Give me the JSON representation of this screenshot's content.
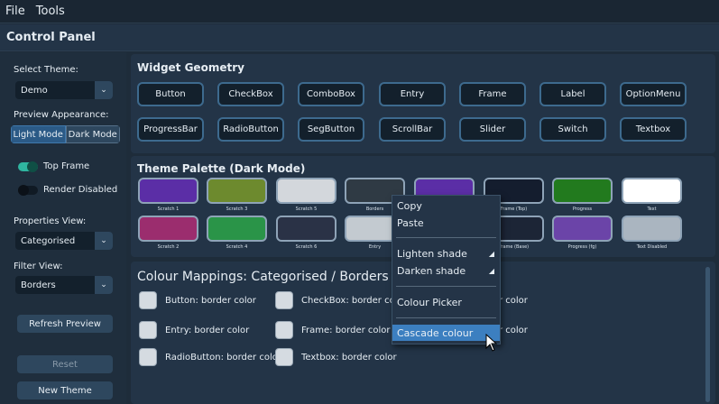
{
  "menu": {
    "file": "File",
    "tools": "Tools"
  },
  "window": {
    "title": "Control Panel"
  },
  "sidebar": {
    "theme_label": "Select Theme:",
    "theme_value": "Demo",
    "appearance_label": "Preview Appearance:",
    "light_mode": "Light Mode",
    "dark_mode": "Dark Mode",
    "top_frame": "Top Frame",
    "render_disabled": "Render Disabled",
    "properties_label": "Properties View:",
    "properties_value": "Categorised",
    "filter_label": "Filter View:",
    "filter_value": "Borders",
    "refresh": "Refresh Preview",
    "reset": "Reset",
    "new_theme": "New Theme"
  },
  "geometry": {
    "title": "Widget Geometry",
    "row1": [
      "Button",
      "CheckBox",
      "ComboBox",
      "Entry",
      "Frame",
      "Label",
      "OptionMenu"
    ],
    "row2": [
      "ProgressBar",
      "RadioButton",
      "SegButton",
      "ScrollBar",
      "Slider",
      "Switch",
      "Textbox"
    ]
  },
  "palette": {
    "title": "Theme Palette (Dark Mode)",
    "row1": [
      {
        "label": "Scratch 1",
        "color": "#5b2ea6"
      },
      {
        "label": "Scratch 3",
        "color": "#6d8a2e"
      },
      {
        "label": "Scratch 5",
        "color": "#d3d7dc"
      },
      {
        "label": "Borders",
        "color": "#2f3a44"
      },
      {
        "label": "",
        "color": "#5b2ea6"
      },
      {
        "label": "Frame (Top)",
        "color": "#141d2e"
      },
      {
        "label": "Progress",
        "color": "#227a1e"
      },
      {
        "label": "Text",
        "color": "#ffffff"
      }
    ],
    "row2": [
      {
        "label": "Scratch 2",
        "color": "#9b2d6e"
      },
      {
        "label": "Scratch 4",
        "color": "#2a9448"
      },
      {
        "label": "Scratch 6",
        "color": "#2a3246"
      },
      {
        "label": "Entry",
        "color": "#c3cad0"
      },
      {
        "label": "",
        "color": "#2a3246"
      },
      {
        "label": "Frame (Base)",
        "color": "#1c2536"
      },
      {
        "label": "Progress (fg)",
        "color": "#6b44a8"
      },
      {
        "label": "Text Disabled",
        "color": "#aab5c0"
      }
    ]
  },
  "mappings": {
    "title": "Colour Mappings: Categorised / Borders",
    "col1": [
      "Button: border color",
      "Entry: border color",
      "RadioButton: border color"
    ],
    "col2": [
      "CheckBox: border color",
      "Frame: border color",
      "Textbox: border color"
    ],
    "col3": [
      "r color",
      "r color"
    ]
  },
  "context_menu": {
    "copy": "Copy",
    "paste": "Paste",
    "lighten": "Lighten shade",
    "darken": "Darken shade",
    "picker": "Colour Picker",
    "cascade": "Cascade colour"
  },
  "colors": {
    "accent": "#2fb5a0",
    "button_border": "#3d6a8e",
    "highlight": "#3c7fc0"
  }
}
